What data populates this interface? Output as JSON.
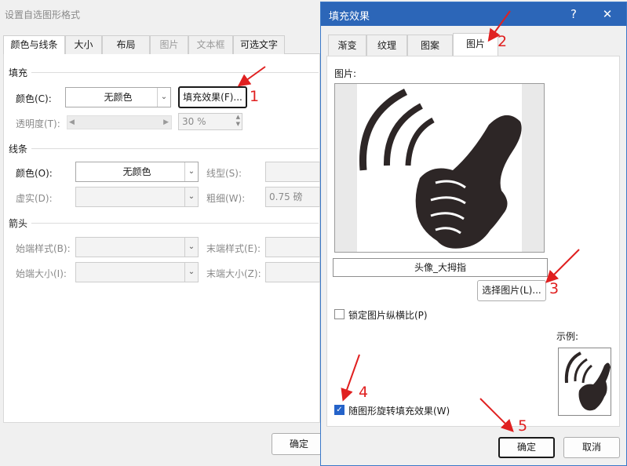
{
  "back_dialog": {
    "title": "设置自选图形格式",
    "tabs": [
      {
        "label": "颜色与线条",
        "state": "active"
      },
      {
        "label": "大小",
        "state": "normal"
      },
      {
        "label": "布局",
        "state": "normal"
      },
      {
        "label": "图片",
        "state": "disabled"
      },
      {
        "label": "文本框",
        "state": "disabled"
      },
      {
        "label": "可选文字",
        "state": "normal"
      }
    ],
    "fill": {
      "section": "填充",
      "color_label": "颜色(C):",
      "color_value": "无颜色",
      "fill_effects_button": "填充效果(F)...",
      "transparency_label": "透明度(T):",
      "transparency_value": "30 %"
    },
    "line": {
      "section": "线条",
      "color_label": "颜色(O):",
      "color_value": "无颜色",
      "style_label": "线型(S):",
      "dash_label": "虚实(D):",
      "weight_label": "粗细(W):",
      "weight_value": "0.75 磅"
    },
    "arrows": {
      "section": "箭头",
      "begin_style_label": "始端样式(B):",
      "end_style_label": "末端样式(E):",
      "begin_size_label": "始端大小(I):",
      "end_size_label": "末端大小(Z):"
    },
    "ok_button": "确定"
  },
  "front_dialog": {
    "title": "填充效果",
    "help_label": "?",
    "close_label": "✕",
    "tabs": [
      {
        "label": "渐变",
        "state": "normal"
      },
      {
        "label": "纹理",
        "state": "normal"
      },
      {
        "label": "图案",
        "state": "normal"
      },
      {
        "label": "图片",
        "state": "active"
      }
    ],
    "picture_label": "图片:",
    "picture_name": "头像_大拇指",
    "select_button": "选择图片(L)...",
    "lock_aspect_label": "锁定图片纵横比(P)",
    "lock_aspect_checked": false,
    "rotate_label": "随图形旋转填充效果(W)",
    "rotate_checked": true,
    "sample_label": "示例:",
    "ok_button": "确定",
    "cancel_button": "取消"
  },
  "annotations": [
    "1",
    "2",
    "3",
    "4",
    "5"
  ],
  "colors": {
    "accent": "#2c66b8",
    "annotation": "#e02020",
    "check": "#2563c9"
  }
}
